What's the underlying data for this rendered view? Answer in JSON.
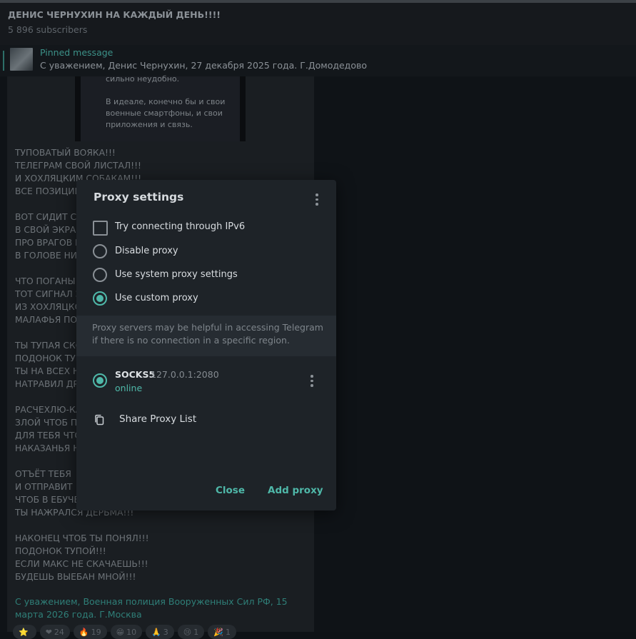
{
  "channel": {
    "title": "ДЕНИС ЧЕРНУХИН НА КАЖДЫЙ ДЕНЬ!!!!",
    "subscribers": "5 896 subscribers"
  },
  "pinned": {
    "label": "Pinned message",
    "text": "С уважением, Денис Чернухин, 27 декабря 2025 года. Г.Домодедово"
  },
  "message": {
    "image_text": "сильно неудобно.\n\n В идеале, конечно бы и свои\nвоенные смартфоны, и свои\nприложения и связь.",
    "body": "ТУПОВАТЫЙ ВОЯКА!!!\nТЕЛЕГРАМ СВОЙ ЛИСТАЛ!!!\nИ ХОХЛЯЦКИМ СОБАКАМ!!!\nВСЕ ПОЗИЦИИ\n\nВОТ СИДИТ С\nВ СВОЙ ЭКРАН\nПРО ВРАГОВ Н\nВ ГОЛОВЕ НИ\n\nЧТО ПОГАНЫ\nТОТ СИГНАЛ З\nИЗ ХОХЛЯЦКО\nМАЛАФЬЯ ПОТ\n\nТЫ ТУПАЯ СКС\nПОДОНОК ТУП\nТЫ НА ВСЕХ Н\nНАТРАВИЛ ДР\n\nРАСЧЕХЛЮ-КА\nЗЛОЙ ЧТОБ П\nДЛЯ ТЕБЯ ЧТО\nНАКАЗАНЬЯ Н\n\nОТЪЁТ ТЕБЯ\nИ ОТПРАВИТ\nЧТОБ В ЕБУЧЕ\nТЫ НАЖРАЛСЯ ДЕРЬМА!!!\n\nНАКОНЕЦ ЧТОБ ТЫ ПОНЯЛ!!!\nПОДОНОК ТУПОЙ!!!\nЕСЛИ МАКС НЕ СКАЧАЕШЬ!!!\nБУДЕШЬ ВЫЕБАН МНОЙ!!!",
    "signature": "С уважением, Военная полиция Вооруженных Сил РФ, 15 марта 2026 года. Г.Москва",
    "reactions": [
      {
        "emoji": "⭐",
        "count": ""
      },
      {
        "emoji": "❤",
        "count": "24"
      },
      {
        "emoji": "🔥",
        "count": "19"
      },
      {
        "emoji": "😁",
        "count": "10"
      },
      {
        "emoji": "🙏",
        "count": "3"
      },
      {
        "emoji": "😢",
        "count": "1"
      },
      {
        "emoji": "🎉",
        "count": "1"
      }
    ]
  },
  "dialog": {
    "title": "Proxy settings",
    "options": {
      "ipv6": "Try connecting through IPv6",
      "disable": "Disable proxy",
      "system": "Use system proxy settings",
      "custom": "Use custom proxy"
    },
    "selected_option": "custom",
    "info": "Proxy servers may be helpful in accessing Telegram if there is no connection in a specific region.",
    "proxy": {
      "type": "SOCKS5",
      "address": "127.0.0.1:2080",
      "status": "online"
    },
    "share_label": "Share Proxy List",
    "close_label": "Close",
    "add_label": "Add proxy"
  },
  "colors": {
    "accent": "#4fb8a9",
    "dialog_bg": "#1e2328",
    "app_bg": "#0e1216"
  }
}
